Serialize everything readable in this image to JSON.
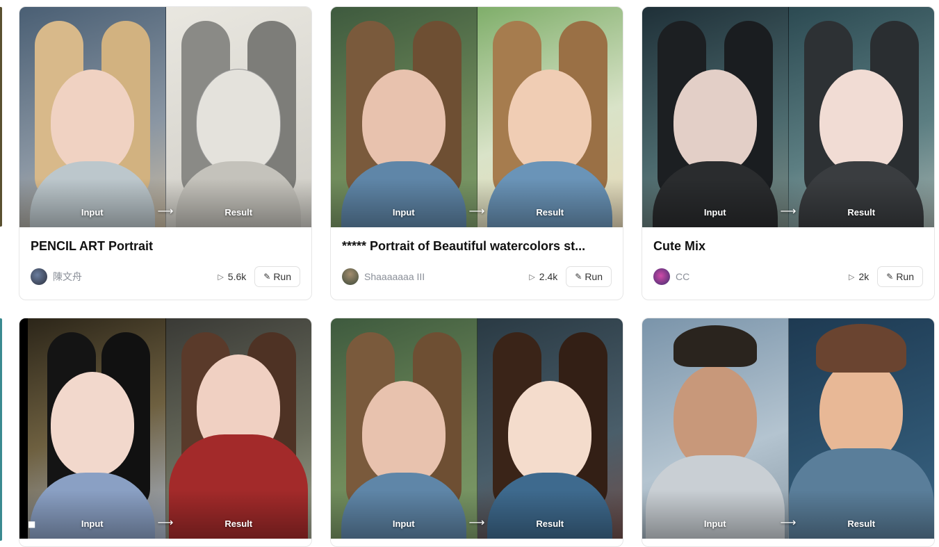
{
  "labels": {
    "input": "Input",
    "result": "Result",
    "run": "Run"
  },
  "cards": [
    {
      "title": "PENCIL ART Portrait",
      "author": "陳文舟",
      "plays": "5.6k"
    },
    {
      "title": "***** Portrait of Beautiful watercolors st...",
      "author": "Shaaaaaaa III",
      "plays": "2.4k"
    },
    {
      "title": "Cute Mix",
      "author": "CC",
      "plays": "2k"
    },
    {
      "title": "",
      "author": "",
      "plays": ""
    },
    {
      "title": "",
      "author": "",
      "plays": ""
    },
    {
      "title": "",
      "author": "",
      "plays": ""
    }
  ],
  "icons": {
    "play": "play-icon",
    "run": "magic-wand-icon",
    "arrow": "arrow-right-icon",
    "camera": "video-camera-icon"
  }
}
